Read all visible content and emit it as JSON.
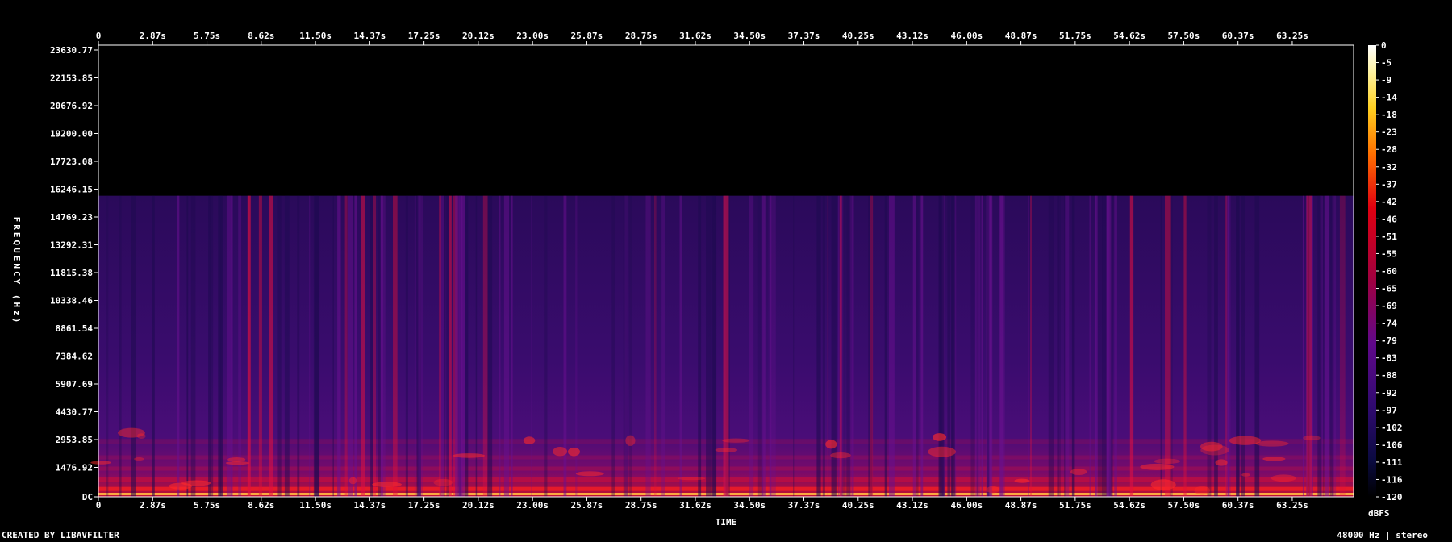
{
  "chart_data": {
    "type": "heatmap",
    "xlabel": "TIME",
    "ylabel": "FREQUENCY (Hz)",
    "x_ticks": [
      "0",
      "2.87s",
      "5.75s",
      "8.62s",
      "11.50s",
      "14.37s",
      "17.25s",
      "20.12s",
      "23.00s",
      "25.87s",
      "28.75s",
      "31.62s",
      "34.50s",
      "37.37s",
      "40.25s",
      "43.12s",
      "46.00s",
      "48.87s",
      "51.75s",
      "54.62s",
      "57.50s",
      "60.37s",
      "63.25s"
    ],
    "y_ticks": [
      "23630.77",
      "22153.85",
      "20676.92",
      "19200.00",
      "17723.08",
      "16246.15",
      "14769.23",
      "13292.31",
      "11815.38",
      "10338.46",
      "8861.54",
      "7384.62",
      "5907.69",
      "4430.77",
      "2953.85",
      "1476.92",
      "DC"
    ],
    "y_range_hz": [
      0,
      24000
    ],
    "x_range_s": [
      0,
      66.5
    ],
    "frequency_cutoff_hz": 16000,
    "colorbar": {
      "unit": "dBFS",
      "ticks": [
        "0",
        "-5",
        "-9",
        "-14",
        "-18",
        "-23",
        "-28",
        "-32",
        "-37",
        "-42",
        "-46",
        "-51",
        "-55",
        "-60",
        "-65",
        "-69",
        "-74",
        "-79",
        "-83",
        "-88",
        "-92",
        "-97",
        "-102",
        "-106",
        "-111",
        "-116",
        "-120"
      ],
      "range": [
        -120,
        0
      ]
    }
  },
  "footer": {
    "created_by": "CREATED BY LIBAVFILTER",
    "info": "48000 Hz | stereo"
  }
}
